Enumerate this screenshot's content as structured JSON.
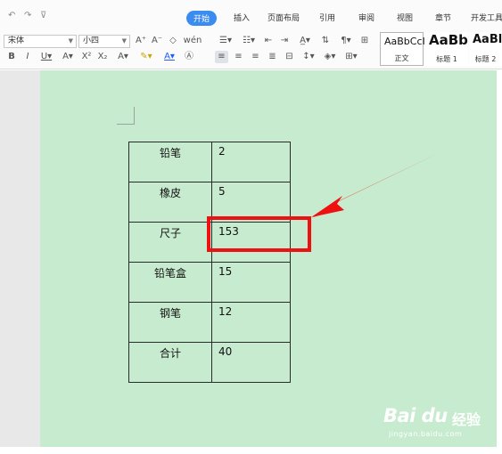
{
  "quick_access": {
    "undo_icon": "↶",
    "redo_icon": "↷",
    "customize_icon": "⊽"
  },
  "tabs": [
    {
      "label": "开始",
      "active": true
    },
    {
      "label": "插入",
      "active": false
    },
    {
      "label": "页面布局",
      "active": false
    },
    {
      "label": "引用",
      "active": false
    },
    {
      "label": "审阅",
      "active": false
    },
    {
      "label": "视图",
      "active": false
    },
    {
      "label": "章节",
      "active": false
    },
    {
      "label": "开发工具",
      "active": false
    }
  ],
  "ribbon": {
    "font_name": "宋体",
    "font_size": "小四",
    "styles": [
      {
        "sample": "AaBbCcI",
        "label": "正文",
        "selected": true
      },
      {
        "sample": "AaBb",
        "label": "标题 1",
        "selected": false
      },
      {
        "sample": "AaBl",
        "label": "标题 2",
        "selected": false
      }
    ]
  },
  "table": {
    "rows": [
      {
        "item": "铅笔",
        "qty": "2"
      },
      {
        "item": "橡皮",
        "qty": "5"
      },
      {
        "item": "尺子",
        "qty": "153"
      },
      {
        "item": "铅笔盒",
        "qty": "15"
      },
      {
        "item": "钢笔",
        "qty": "12"
      },
      {
        "item": "合计",
        "qty": "40"
      }
    ]
  },
  "watermark": {
    "logo": "Bai du",
    "logo_cn": "经验",
    "url": "jingyan.baidu.com"
  },
  "colors": {
    "accent": "#3b8cf0",
    "page_bg": "#c7ebce",
    "annotation": "#ee1111"
  }
}
